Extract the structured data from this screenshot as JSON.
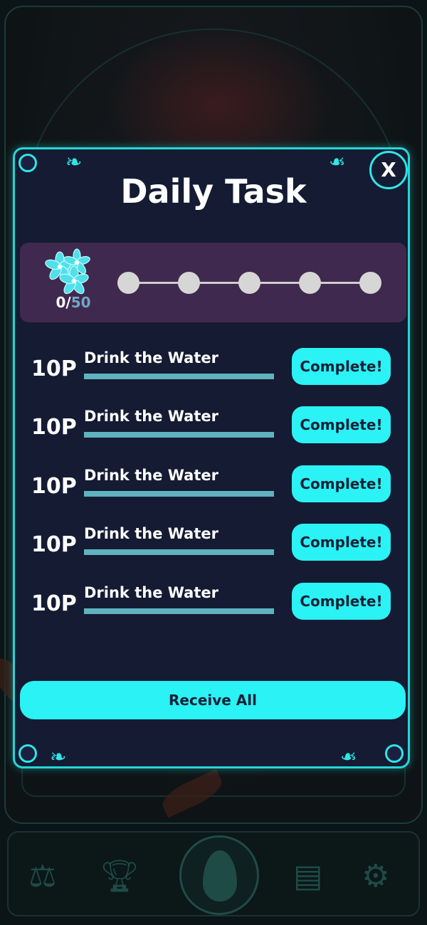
{
  "modal": {
    "title": "Daily Task",
    "close_label": "X"
  },
  "progress": {
    "current": "0",
    "separator": "/",
    "max": "50",
    "milestones": 5
  },
  "tasks": [
    {
      "points": "10P",
      "name": "Drink the Water",
      "button": "Complete!"
    },
    {
      "points": "10P",
      "name": "Drink the Water",
      "button": "Complete!"
    },
    {
      "points": "10P",
      "name": "Drink the Water",
      "button": "Complete!"
    },
    {
      "points": "10P",
      "name": "Drink the Water",
      "button": "Complete!"
    },
    {
      "points": "10P",
      "name": "Drink the Water",
      "button": "Complete!"
    }
  ],
  "receive_all_label": "Receive All",
  "bottom_nav": {
    "items": [
      {
        "icon": "scales-icon"
      },
      {
        "icon": "trophy-icon"
      },
      {
        "icon": "flame-icon"
      },
      {
        "icon": "document-icon"
      },
      {
        "icon": "gear-icon"
      }
    ]
  },
  "colors": {
    "accent": "#2af2f5",
    "panel": "#141b33",
    "progress_card": "#40294e",
    "border": "#26d6d6"
  }
}
